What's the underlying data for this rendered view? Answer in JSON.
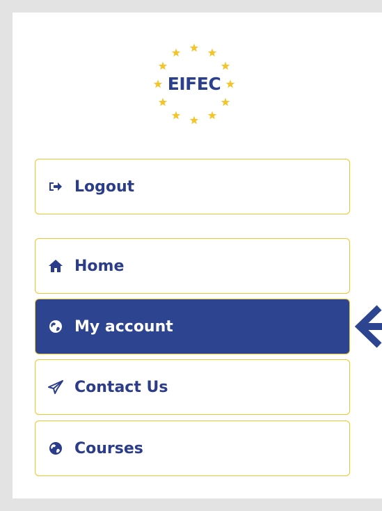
{
  "logo": {
    "text": "EIFEC",
    "icon": "eu-stars-logo-icon"
  },
  "colors": {
    "accent_border": "#f3c42c",
    "brand_blue": "#2d4491",
    "text_blue": "#2b3d8a",
    "background": "#e3e3e3"
  },
  "menu": {
    "logout": {
      "label": "Logout",
      "icon": "sign-out-icon"
    },
    "items": [
      {
        "label": "Home",
        "icon": "home-icon",
        "active": false
      },
      {
        "label": "My account",
        "icon": "globe-icon",
        "active": true
      },
      {
        "label": "Contact Us",
        "icon": "paper-plane-icon",
        "active": false
      },
      {
        "label": "Courses",
        "icon": "globe-icon",
        "active": false
      }
    ]
  },
  "pointer": {
    "icon": "arrow-left-icon"
  }
}
